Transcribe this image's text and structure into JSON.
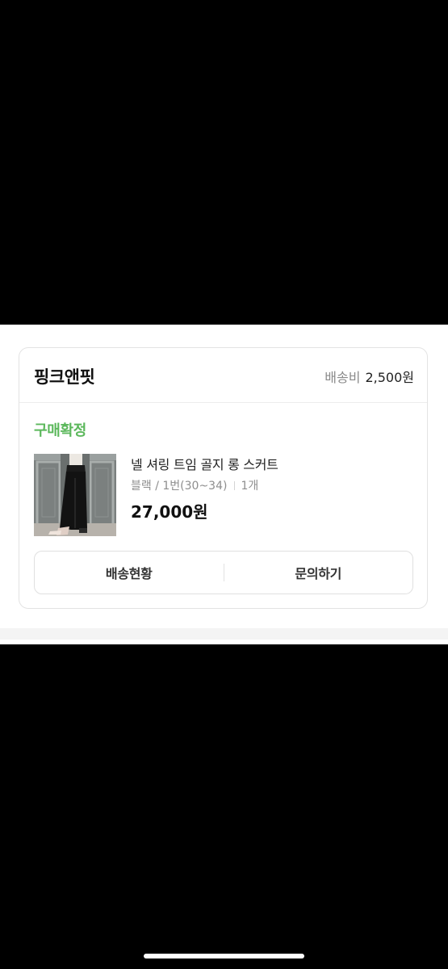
{
  "order_card": {
    "store_name": "핑크앤핏",
    "shipping_label": "배송비",
    "shipping_fee": "2,500원",
    "status": "구매확정",
    "status_color": "#5cb85c",
    "product": {
      "name": "넬 셔링 트임 골지 롱 스커트",
      "option": "블랙 / 1번(30~34)",
      "quantity": "1개",
      "price": "27,000원",
      "thumbnail": "black-long-skirt-photo"
    },
    "buttons": {
      "delivery_status": "배송현황",
      "inquiry": "문의하기"
    }
  }
}
